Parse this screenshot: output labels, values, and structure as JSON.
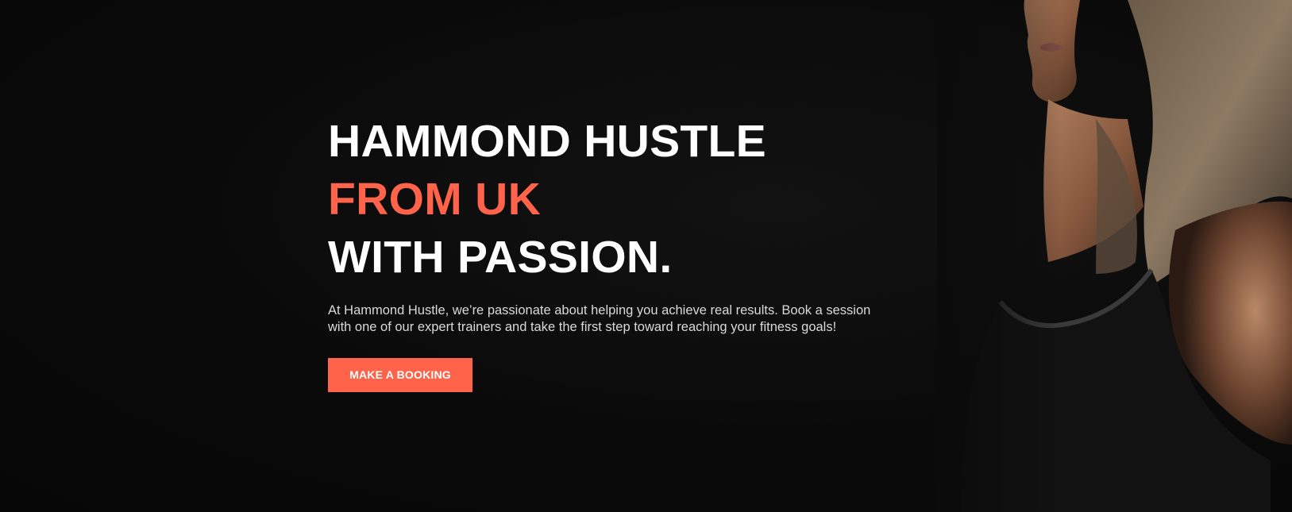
{
  "hero": {
    "headline": {
      "line1": "HAMMOND HUSTLE",
      "line2": "FROM UK",
      "line3": "WITH PASSION."
    },
    "description": "At Hammond Hustle, we’re passionate about helping you achieve real results. Book a session with one of our expert trainers and take the first step toward reaching your fitness goals!",
    "cta_label": "MAKE A BOOKING",
    "photo": "woman-in-sports-top-photo"
  },
  "colors": {
    "background": "#0b0b0b",
    "accent": "#ff634a",
    "headline_text": "#ffffff",
    "body_text": "#d9d9d9"
  }
}
